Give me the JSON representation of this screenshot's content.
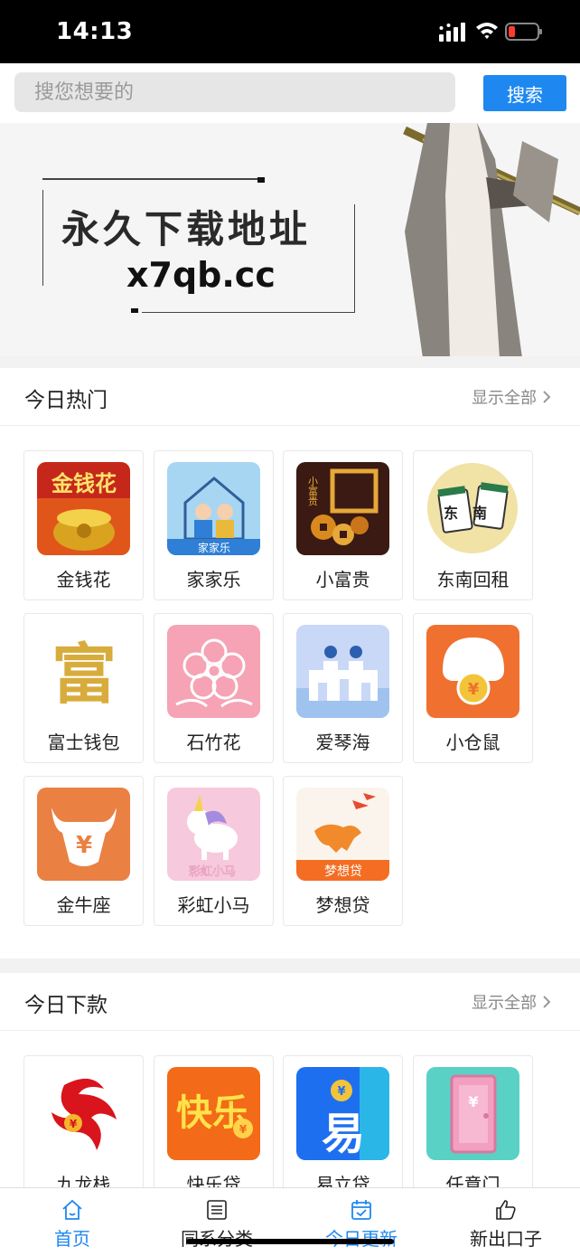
{
  "status": {
    "time": "14:13"
  },
  "search": {
    "placeholder": "搜您想要的",
    "button_label": "搜索"
  },
  "banner": {
    "title": "永久下载地址",
    "url": "x7qb.cc"
  },
  "hot": {
    "title": "今日热门",
    "show_all": "显示全部",
    "apps": [
      {
        "name": "金钱花",
        "icon": "coin-pot-icon",
        "icon_text": "金钱花",
        "color": "#e0561a"
      },
      {
        "name": "家家乐",
        "icon": "family-house-icon",
        "icon_text": "家家乐",
        "color": "#2f7fd6"
      },
      {
        "name": "小富贵",
        "icon": "fortune-coins-icon",
        "icon_text": "小富贵",
        "color": "#3a1a12"
      },
      {
        "name": "东南回租",
        "icon": "mahjong-tiles-icon",
        "icon_text": "东南",
        "color": "#f1e2a6"
      },
      {
        "name": "富士钱包",
        "icon": "gold-character-icon",
        "icon_text": "富",
        "color": "#ffffff"
      },
      {
        "name": "石竹花",
        "icon": "pink-flower-icon",
        "icon_text": "",
        "color": "#f5a3b5"
      },
      {
        "name": "爱琴海",
        "icon": "seaside-castle-icon",
        "icon_text": "",
        "color": "#a9c6f2"
      },
      {
        "name": "小仓鼠",
        "icon": "hamster-coin-icon",
        "icon_text": "",
        "color": "#f07030"
      },
      {
        "name": "金牛座",
        "icon": "bull-yuan-icon",
        "icon_text": "",
        "color": "#ea8042"
      },
      {
        "name": "彩虹小马",
        "icon": "unicorn-icon",
        "icon_text": "彩虹小马",
        "color": "#f7c9dc"
      },
      {
        "name": "梦想贷",
        "icon": "running-horse-icon",
        "icon_text": "梦想贷",
        "color": "#f36d22"
      }
    ]
  },
  "loans": {
    "title": "今日下款",
    "show_all": "显示全部",
    "apps": [
      {
        "name": "九龙栈",
        "icon": "red-dragon-icon",
        "icon_text": "",
        "color": "#d9141c"
      },
      {
        "name": "快乐贷",
        "icon": "happy-text-icon",
        "icon_text": "快乐",
        "color": "#f36a18"
      },
      {
        "name": "易立贷",
        "icon": "yi-coin-icon",
        "icon_text": "易",
        "color": "#1e6ff0"
      },
      {
        "name": "任意门",
        "icon": "pink-door-icon",
        "icon_text": "",
        "color": "#5ad1c5"
      }
    ]
  },
  "tabs": [
    {
      "label": "首页",
      "icon": "home-icon",
      "active": true
    },
    {
      "label": "同系分类",
      "icon": "list-icon",
      "active": false
    },
    {
      "label": "今日更新",
      "icon": "calendar-check-icon",
      "active": true
    },
    {
      "label": "新出口子",
      "icon": "thumbs-up-icon",
      "active": false
    }
  ],
  "colors": {
    "accent": "#1e88f0",
    "text": "#222222",
    "muted": "#888888"
  }
}
